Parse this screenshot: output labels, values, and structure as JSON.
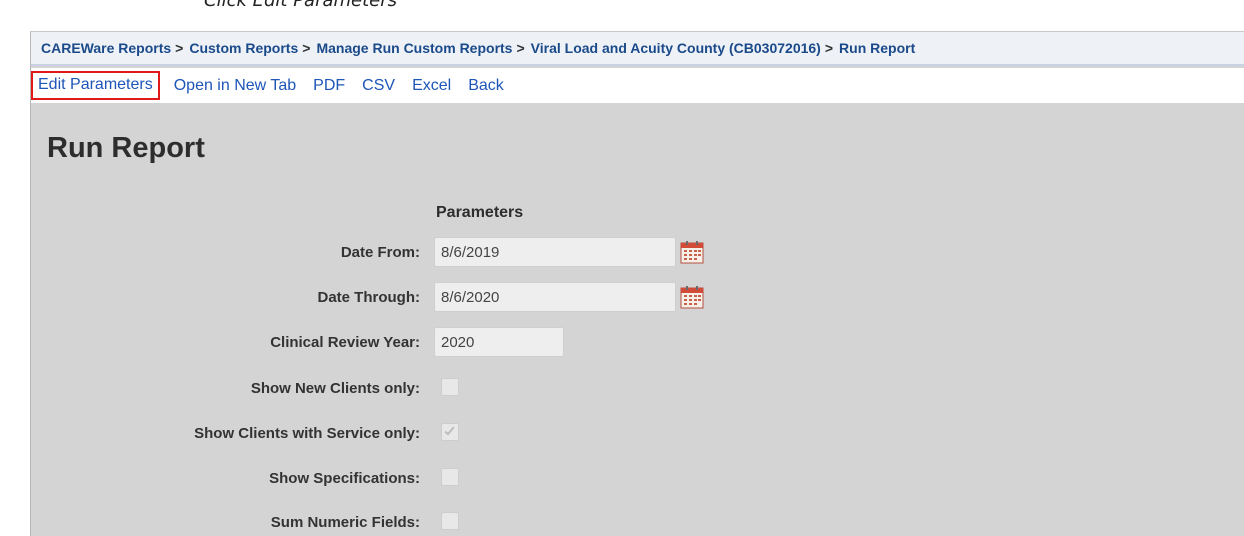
{
  "caption": "Click Edit Parameters",
  "breadcrumb": {
    "items": [
      "CAREWare Reports",
      "Custom Reports",
      "Manage Run Custom Reports",
      "Viral Load and Acuity County (CB03072016)",
      "Run Report"
    ],
    "separator": ">"
  },
  "toolbar": {
    "edit_parameters": "Edit Parameters",
    "open_in_new_tab": "Open in New Tab",
    "pdf": "PDF",
    "csv": "CSV",
    "excel": "Excel",
    "back": "Back"
  },
  "page": {
    "title": "Run Report",
    "params_heading": "Parameters"
  },
  "parameters": {
    "date_from": {
      "label": "Date From:",
      "value": "8/6/2019",
      "icon": "calendar-icon"
    },
    "date_through": {
      "label": "Date Through:",
      "value": "8/6/2020",
      "icon": "calendar-icon"
    },
    "clinical_review_year": {
      "label": "Clinical Review Year:",
      "value": "2020"
    },
    "show_new_clients_only": {
      "label": "Show New Clients only:",
      "checked": false
    },
    "show_clients_with_service_only": {
      "label": "Show Clients with Service only:",
      "checked": true
    },
    "show_specifications": {
      "label": "Show Specifications:",
      "checked": false
    },
    "sum_numeric_fields": {
      "label": "Sum Numeric Fields:",
      "checked": false
    }
  },
  "colors": {
    "highlight_border": "#e01818",
    "link": "#1d55b8",
    "breadcrumb_link": "#1a4a8a",
    "background": "#d4d4d4"
  }
}
